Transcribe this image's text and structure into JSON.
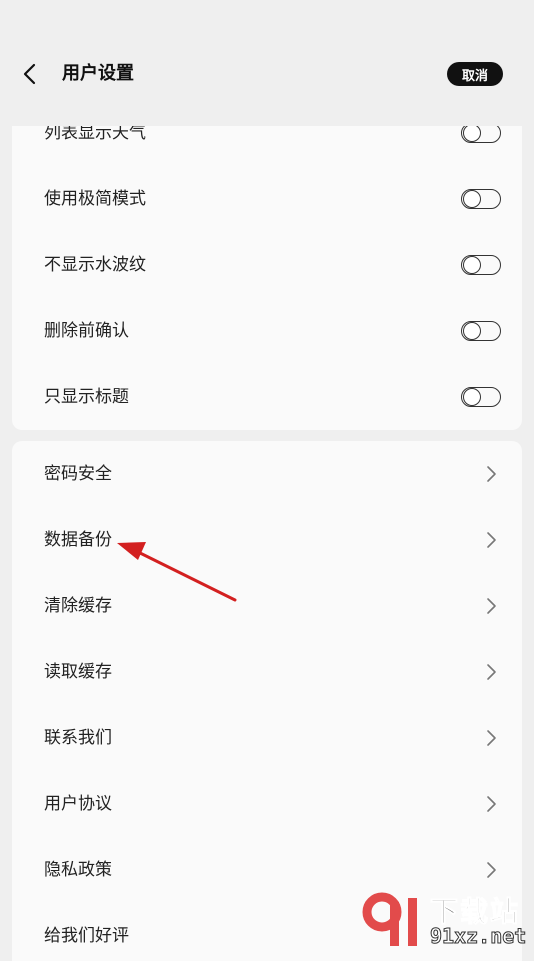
{
  "header": {
    "title": "用户设置",
    "cancel_label": "取消"
  },
  "toggle_settings": [
    {
      "label": "列表显示天气",
      "enabled": false
    },
    {
      "label": "使用极简模式",
      "enabled": false
    },
    {
      "label": "不显示水波纹",
      "enabled": false
    },
    {
      "label": "删除前确认",
      "enabled": false
    },
    {
      "label": "只显示标题",
      "enabled": false
    }
  ],
  "link_settings": [
    {
      "label": "密码安全"
    },
    {
      "label": "数据备份"
    },
    {
      "label": "清除缓存"
    },
    {
      "label": "读取缓存"
    },
    {
      "label": "联系我们"
    },
    {
      "label": "用户协议"
    },
    {
      "label": "隐私政策"
    },
    {
      "label": "给我们好评"
    }
  ],
  "annotation": {
    "color": "#d32020",
    "target": "数据备份"
  },
  "watermark": {
    "line1": "下载站",
    "line2": "91xz.net"
  },
  "colors": {
    "background": "#efefef",
    "card": "#fafafa",
    "button_dark": "#111111"
  }
}
